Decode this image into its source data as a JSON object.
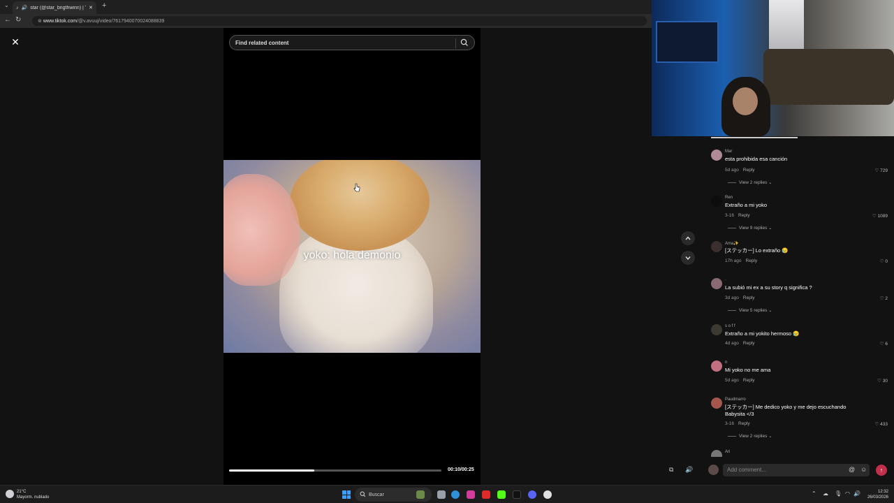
{
  "browser": {
    "tab_title": "star (@star_brigthwinn) | Tik",
    "url_host": "www.tiktok.com",
    "url_path": "/@v.avuuj/video/7617940070024088839"
  },
  "search": {
    "placeholder": "Find related content"
  },
  "video": {
    "caption": "yoko: hola demonio",
    "timecode": "00:10/00:25",
    "progress": 0.4
  },
  "comments": [
    {
      "name": "Mar",
      "text": "esta prohibida esa canción",
      "time": "5d ago",
      "reply": "Reply",
      "likes": "729",
      "replies": "View 2 replies",
      "avatar": "#b08a96"
    },
    {
      "name": "Ren",
      "text": "Extraño a mi yoko",
      "time": "3-16",
      "reply": "Reply",
      "likes": "1089",
      "replies": "View 9 replies",
      "avatar": "#0d0d0d"
    },
    {
      "name": "Ama✨",
      "text": "[ステッカー] Lo extraño 😥",
      "time": "17h ago",
      "reply": "Reply",
      "likes": "0",
      "replies": "",
      "avatar": "#3a2e2e"
    },
    {
      "name": "·",
      "text": "La subió mi ex a su story q significa ?",
      "time": "3d ago",
      "reply": "Reply",
      "likes": "2",
      "replies": "View 5 replies",
      "avatar": "#8a6a72"
    },
    {
      "name": "s o f f",
      "text": "Extraño a mi yokito hermoso 😥",
      "time": "4d ago",
      "reply": "Reply",
      "likes": "6",
      "replies": "",
      "avatar": "#3c3a30"
    },
    {
      "name": "n",
      "text": "Mi yoko no me ama",
      "time": "5d ago",
      "reply": "Reply",
      "likes": "30",
      "replies": "",
      "avatar": "#c07080"
    },
    {
      "name": "Paudmarro",
      "text": "[ステッカー] Me dedico yoko y me dejo escuchando Babysita </3",
      "time": "3-16",
      "reply": "Reply",
      "likes": "433",
      "replies": "View 2 replies",
      "avatar": "#a4574a"
    },
    {
      "name": "Ari",
      "text": "",
      "time": "",
      "reply": "",
      "likes": "",
      "replies": "",
      "avatar": "#777777"
    }
  ],
  "comment_bar": {
    "placeholder": "Add comment..."
  },
  "taskbar": {
    "weather_temp": "21°C",
    "weather_desc": "Mayorm. nublado",
    "search_label": "Buscar",
    "time": "12:32",
    "date": "26/03/2026"
  },
  "colors": {
    "accent": "#fe2c55",
    "send": "#c0304a"
  }
}
